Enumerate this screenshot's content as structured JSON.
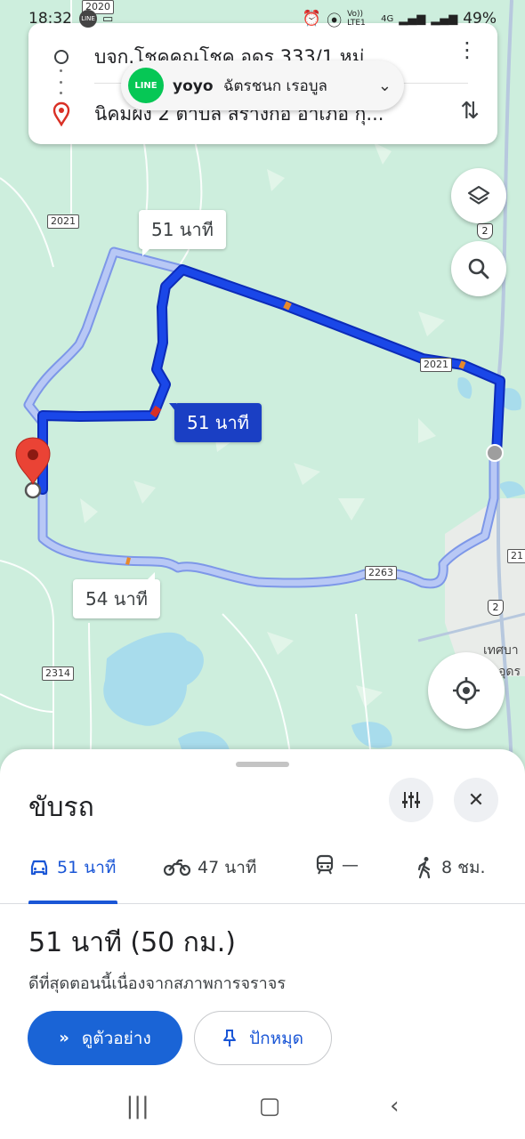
{
  "status_bar": {
    "time": "18:32",
    "network": "Vo)) LTE1",
    "signal_gen": "4G",
    "battery": "49%"
  },
  "search_card": {
    "origin": "บจก.โชคคูณโชค อุดร 333/1 หมู่...",
    "destination": "นิคมผัง 2 ตำบล สร้างก่อ อำเภอ กุ..."
  },
  "line_notification": {
    "app": "LINE",
    "sender": "yoyo",
    "message": "ฉัตรชนก เรอบูล"
  },
  "map": {
    "road_labels": [
      "2020",
      "2021",
      "2021",
      "2263",
      "2314",
      "21"
    ],
    "shields": [
      "2",
      "2",
      "2"
    ],
    "town_label": "เทศบา",
    "town_label2": "อุดร",
    "route_labels": {
      "alt_top": "51 นาที",
      "selected": "51 นาที",
      "alt_bottom": "54 นาที"
    }
  },
  "sheet": {
    "mode_title": "ขับรถ",
    "tabs": [
      {
        "label": "51 นาที",
        "icon": "car-icon"
      },
      {
        "label": "47 นาที",
        "icon": "motorcycle-icon"
      },
      {
        "label": "—",
        "icon": "train-icon"
      },
      {
        "label": "8 ชม.",
        "icon": "walk-icon"
      }
    ],
    "duration": "51 นาที (50 กม.)",
    "note": "ดีที่สุดตอนนี้เนื่องจากสภาพการจราจร",
    "preview_label": "ดูตัวอย่าง",
    "pin_label": "ปักหมุด"
  },
  "colors": {
    "route_selected": "#1a3fd6",
    "route_alt": "#a9bdf5",
    "accent": "#1a64d6",
    "map_bg": "#cdeedd",
    "water": "#a8dcec"
  }
}
